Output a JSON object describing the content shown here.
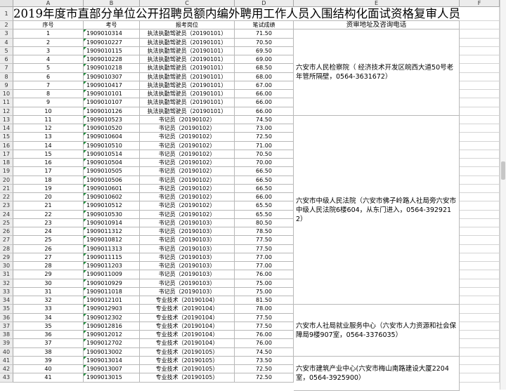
{
  "columns": [
    "A",
    "B",
    "C",
    "D",
    "E",
    "F"
  ],
  "title": "2019年度市直部分单位公开招聘员额内编外聘用工作人员入围结构化面试资格复审人员名单",
  "headers": {
    "seq": "序号",
    "exam_no": "考号",
    "position": "报考岗位",
    "score": "笔试成绩",
    "contact": "资审地址及咨询电话"
  },
  "rows": [
    {
      "seq": "1",
      "exam_no": "1909010314",
      "position": "执法执勤驾驶员（20190101）",
      "score": "71.50"
    },
    {
      "seq": "2",
      "exam_no": "1909010227",
      "position": "执法执勤驾驶员（20190101）",
      "score": "70.50"
    },
    {
      "seq": "3",
      "exam_no": "1909010115",
      "position": "执法执勤驾驶员（20190101）",
      "score": "69.50"
    },
    {
      "seq": "4",
      "exam_no": "1909010228",
      "position": "执法执勤驾驶员（20190101）",
      "score": "69.00"
    },
    {
      "seq": "5",
      "exam_no": "1909010218",
      "position": "执法执勤驾驶员（20190101）",
      "score": "68.50"
    },
    {
      "seq": "6",
      "exam_no": "1909010307",
      "position": "执法执勤驾驶员（20190101）",
      "score": "68.00"
    },
    {
      "seq": "7",
      "exam_no": "1909010417",
      "position": "执法执勤驾驶员（20190101）",
      "score": "67.00"
    },
    {
      "seq": "8",
      "exam_no": "1909010101",
      "position": "执法执勤驾驶员（20190101）",
      "score": "66.00"
    },
    {
      "seq": "9",
      "exam_no": "1909010107",
      "position": "执法执勤驾驶员（20190101）",
      "score": "66.00"
    },
    {
      "seq": "10",
      "exam_no": "1909010126",
      "position": "执法执勤驾驶员（20190101）",
      "score": "66.00"
    },
    {
      "seq": "11",
      "exam_no": "1909010523",
      "position": "书记员（20190102）",
      "score": "74.50"
    },
    {
      "seq": "12",
      "exam_no": "1909010520",
      "position": "书记员（20190102）",
      "score": "73.00"
    },
    {
      "seq": "13",
      "exam_no": "1909010604",
      "position": "书记员（20190102）",
      "score": "72.50"
    },
    {
      "seq": "14",
      "exam_no": "1909010510",
      "position": "书记员（20190102）",
      "score": "71.00"
    },
    {
      "seq": "15",
      "exam_no": "1909010514",
      "position": "书记员（20190102）",
      "score": "70.50"
    },
    {
      "seq": "16",
      "exam_no": "1909010504",
      "position": "书记员（20190102）",
      "score": "70.00"
    },
    {
      "seq": "17",
      "exam_no": "1909010505",
      "position": "书记员（20190102）",
      "score": "66.50"
    },
    {
      "seq": "18",
      "exam_no": "1909010506",
      "position": "书记员（20190102）",
      "score": "66.50"
    },
    {
      "seq": "19",
      "exam_no": "1909010601",
      "position": "书记员（20190102）",
      "score": "66.50"
    },
    {
      "seq": "20",
      "exam_no": "1909010602",
      "position": "书记员（20190102）",
      "score": "66.00"
    },
    {
      "seq": "21",
      "exam_no": "1909010512",
      "position": "书记员（20190102）",
      "score": "65.50"
    },
    {
      "seq": "22",
      "exam_no": "1909010530",
      "position": "书记员（20190102）",
      "score": "65.50"
    },
    {
      "seq": "23",
      "exam_no": "1909010914",
      "position": "书记员（20190103）",
      "score": "80.50"
    },
    {
      "seq": "24",
      "exam_no": "1909011312",
      "position": "书记员（20190103）",
      "score": "78.50"
    },
    {
      "seq": "25",
      "exam_no": "1909010812",
      "position": "书记员（20190103）",
      "score": "77.50"
    },
    {
      "seq": "26",
      "exam_no": "1909011313",
      "position": "书记员（20190103）",
      "score": "77.50"
    },
    {
      "seq": "27",
      "exam_no": "1909011115",
      "position": "书记员（20190103）",
      "score": "77.00"
    },
    {
      "seq": "28",
      "exam_no": "1909011203",
      "position": "书记员（20190103）",
      "score": "77.00"
    },
    {
      "seq": "29",
      "exam_no": "1909011009",
      "position": "书记员（20190103）",
      "score": "76.00"
    },
    {
      "seq": "30",
      "exam_no": "1909010929",
      "position": "书记员（20190103）",
      "score": "75.00"
    },
    {
      "seq": "31",
      "exam_no": "1909011018",
      "position": "书记员（20190103）",
      "score": "75.00"
    },
    {
      "seq": "32",
      "exam_no": "1909012101",
      "position": "专业技术（20190104）",
      "score": "81.50"
    },
    {
      "seq": "33",
      "exam_no": "1909012903",
      "position": "专业技术（20190104）",
      "score": "78.00"
    },
    {
      "seq": "34",
      "exam_no": "1909012302",
      "position": "专业技术（20190104）",
      "score": "77.50"
    },
    {
      "seq": "35",
      "exam_no": "1909012816",
      "position": "专业技术（20190104）",
      "score": "77.50"
    },
    {
      "seq": "36",
      "exam_no": "1909012012",
      "position": "专业技术（20190104）",
      "score": "76.00"
    },
    {
      "seq": "37",
      "exam_no": "1909012702",
      "position": "专业技术（20190104）",
      "score": "76.00"
    },
    {
      "seq": "38",
      "exam_no": "1909013002",
      "position": "专业技术（20190105）",
      "score": "74.50"
    },
    {
      "seq": "39",
      "exam_no": "1909013014",
      "position": "专业技术（20190105）",
      "score": "73.50"
    },
    {
      "seq": "40",
      "exam_no": "1909013007",
      "position": "专业技术（20190105）",
      "score": "72.50"
    },
    {
      "seq": "41",
      "exam_no": "1909013015",
      "position": "专业技术（20190105）",
      "score": "72.50"
    }
  ],
  "contacts": [
    "六安市人民检察院（ 经济技术开发区皖西大道50号老年管所隔壁，0564-3631672）",
    "六安市中级人民法院（六安市佛子岭路人社局旁六安市中级人民法院6楼604，从东门进入，0564-3929212）",
    "六安市人社局就业服务中心（六安市人力资源和社会保障局9楼907室，0564-3376035）",
    "六安市建筑产业中心(六安市梅山南路建设大厦2204室，0564-3925900）"
  ],
  "colors": {
    "header_bg": "#ececec",
    "grid": "#b8b8b8",
    "marker": "#1f8a3a"
  }
}
